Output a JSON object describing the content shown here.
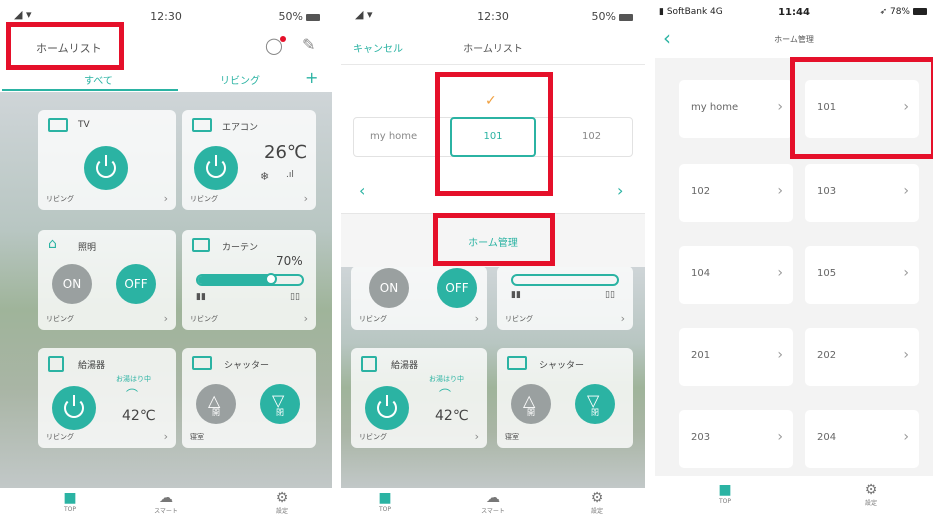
{
  "s1": {
    "status": {
      "time": "12:30",
      "battery": "50%"
    },
    "header": {
      "title": "ホームリスト"
    },
    "tabs": {
      "all": "すべて",
      "living": "リビング",
      "add": "+"
    },
    "cards": {
      "tv": {
        "name": "TV",
        "room": "リビング"
      },
      "ac": {
        "name": "エアコン",
        "temp": "26℃",
        "room": "リビング"
      },
      "light": {
        "name": "照明",
        "on": "ON",
        "off": "OFF",
        "room": "リビング"
      },
      "curtain": {
        "name": "カーテン",
        "level": "70%",
        "level_value": 70,
        "room": "リビング"
      },
      "heater": {
        "name": "給湯器",
        "status": "お湯はり中",
        "temp": "42℃",
        "room": "リビング"
      },
      "shutter": {
        "name": "シャッター",
        "open": "開",
        "close": "閉",
        "room": "寝室"
      }
    },
    "tabbar": {
      "top": "TOP",
      "smart": "スマート",
      "settings": "設定"
    }
  },
  "s2": {
    "status": {
      "time": "12:30",
      "battery": "50%"
    },
    "header": {
      "cancel": "キャンセル",
      "title": "ホームリスト"
    },
    "homes": [
      "my home",
      "101",
      "102"
    ],
    "manage": "ホーム管理",
    "cards": {
      "light": {
        "on": "ON",
        "off": "OFF",
        "room": "リビング"
      },
      "curtain": {
        "room": "リビング"
      },
      "heater": {
        "name": "給湯器",
        "status": "お湯はり中",
        "temp": "42℃",
        "room": "リビング"
      },
      "shutter": {
        "name": "シャッター",
        "open": "開",
        "close": "閉",
        "room": "寝室"
      }
    },
    "tabbar": {
      "top": "TOP",
      "smart": "スマート",
      "settings": "設定"
    }
  },
  "s3": {
    "status": {
      "carrier": "SoftBank 4G",
      "time": "11:44",
      "battery": "78%"
    },
    "header": {
      "back": "‹",
      "title": "ホーム管理"
    },
    "homes": [
      "my home",
      "101",
      "102",
      "103",
      "104",
      "105",
      "201",
      "202",
      "203",
      "204"
    ],
    "chev": "›",
    "tabbar": {
      "top": "TOP",
      "settings": "設定"
    }
  }
}
